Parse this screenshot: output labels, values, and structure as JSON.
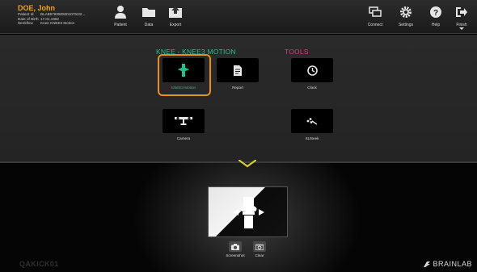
{
  "patient": {
    "name": "DOE, John",
    "fields": [
      {
        "key": "Patient Id",
        "value": "BLAB57835092010762I2..."
      },
      {
        "key": "Date of Birth",
        "value": "17.01.1962"
      },
      {
        "key": "Workflow",
        "value": "Knee KNEE3 Motion"
      }
    ]
  },
  "toolbar": {
    "left": [
      {
        "id": "patient",
        "label": "Patient",
        "icon": "person-icon"
      },
      {
        "id": "data",
        "label": "Data",
        "icon": "folder-icon"
      },
      {
        "id": "export",
        "label": "Export",
        "icon": "export-icon"
      }
    ],
    "right": [
      {
        "id": "connect",
        "label": "Connect",
        "icon": "connect-icon"
      },
      {
        "id": "settings",
        "label": "Settings",
        "icon": "gear-icon"
      },
      {
        "id": "help",
        "label": "Help",
        "icon": "help-icon"
      },
      {
        "id": "finish",
        "label": "Finish",
        "icon": "exit-icon"
      }
    ]
  },
  "sections": {
    "knee_title": "KNEE - KNEE3 MOTION",
    "tools_title": "TOOLS"
  },
  "tiles": {
    "knee_motion": "KNEE3 Motion",
    "report": "Report",
    "camera": "Camera",
    "clock": "Clock",
    "susnip": "SUSeek"
  },
  "stage": {
    "screenshot_label": "Screenshot",
    "clear_label": "Clear"
  },
  "footer": {
    "station": "QAKICK01",
    "brand": "BRAINLAB"
  },
  "colors": {
    "accent_orange": "#e8901c",
    "knee_green": "#1fbf8f",
    "tools_pink": "#e0327a",
    "patient_name": "#f0a21e"
  }
}
